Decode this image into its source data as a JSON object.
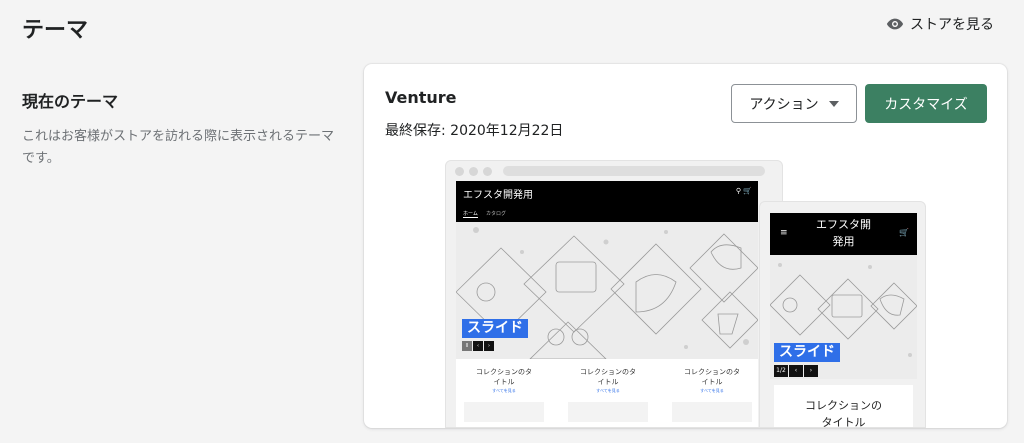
{
  "header": {
    "title": "テーマ",
    "view_store_label": "ストアを見る"
  },
  "current_theme_section": {
    "heading": "現在のテーマ",
    "description": "これはお客様がストアを訪れる際に表示されるテーマです。"
  },
  "theme_card": {
    "name": "Venture",
    "last_saved": "最終保存: 2020年12月22日",
    "actions_label": "アクション",
    "customize_label": "カスタマイズ",
    "accent_color": "#3c8062"
  },
  "preview": {
    "store_name": "エフスタ開発用",
    "mobile_store_name_line1": "エフスタ開",
    "mobile_store_name_line2": "発用",
    "nav_tabs": [
      "ホーム",
      "カタログ"
    ],
    "slide_label": "スライド",
    "desktop_pager": [
      "II",
      "‹",
      "›"
    ],
    "mobile_pager": [
      "1/2",
      "‹",
      "›"
    ],
    "collections": [
      {
        "title_line1": "コレクションのタ",
        "title_line2": "イトル",
        "link": "すべてを見る"
      },
      {
        "title_line1": "コレクションのタ",
        "title_line2": "イトル",
        "link": "すべてを見る"
      },
      {
        "title_line1": "コレクションのタ",
        "title_line2": "イトル",
        "link": "すべてを見る"
      }
    ],
    "mobile_collection_line1": "コレクションの",
    "mobile_collection_line2": "タイトル",
    "slide_color": "#2f6fe8"
  }
}
